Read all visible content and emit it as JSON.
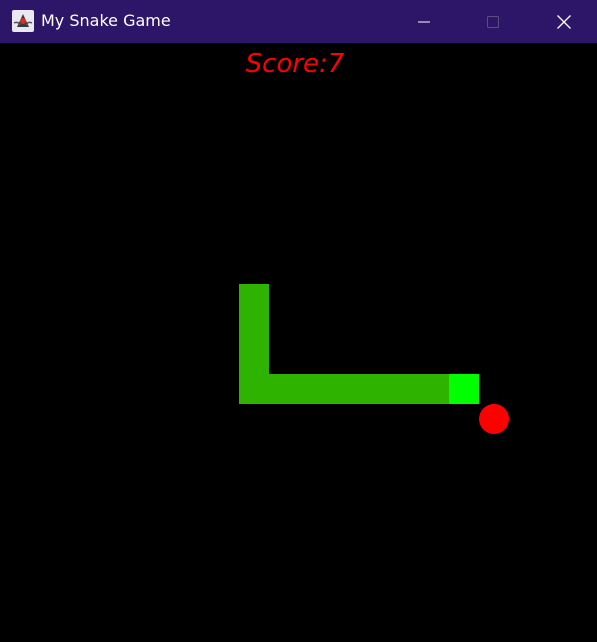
{
  "window": {
    "title": "My Snake Game",
    "titlebar_color": "#2d1568",
    "app_icon": "java-duke-icon",
    "controls": [
      "minimize-icon",
      "maximize-icon",
      "close-icon"
    ]
  },
  "game": {
    "score_label": "Score:",
    "score_value": "7",
    "score_color": "#ff0000",
    "background_color": "#000000",
    "snake_head_color": "#00ff00",
    "snake_body_color": "#2db300",
    "apple_color": "#ff0000"
  }
}
